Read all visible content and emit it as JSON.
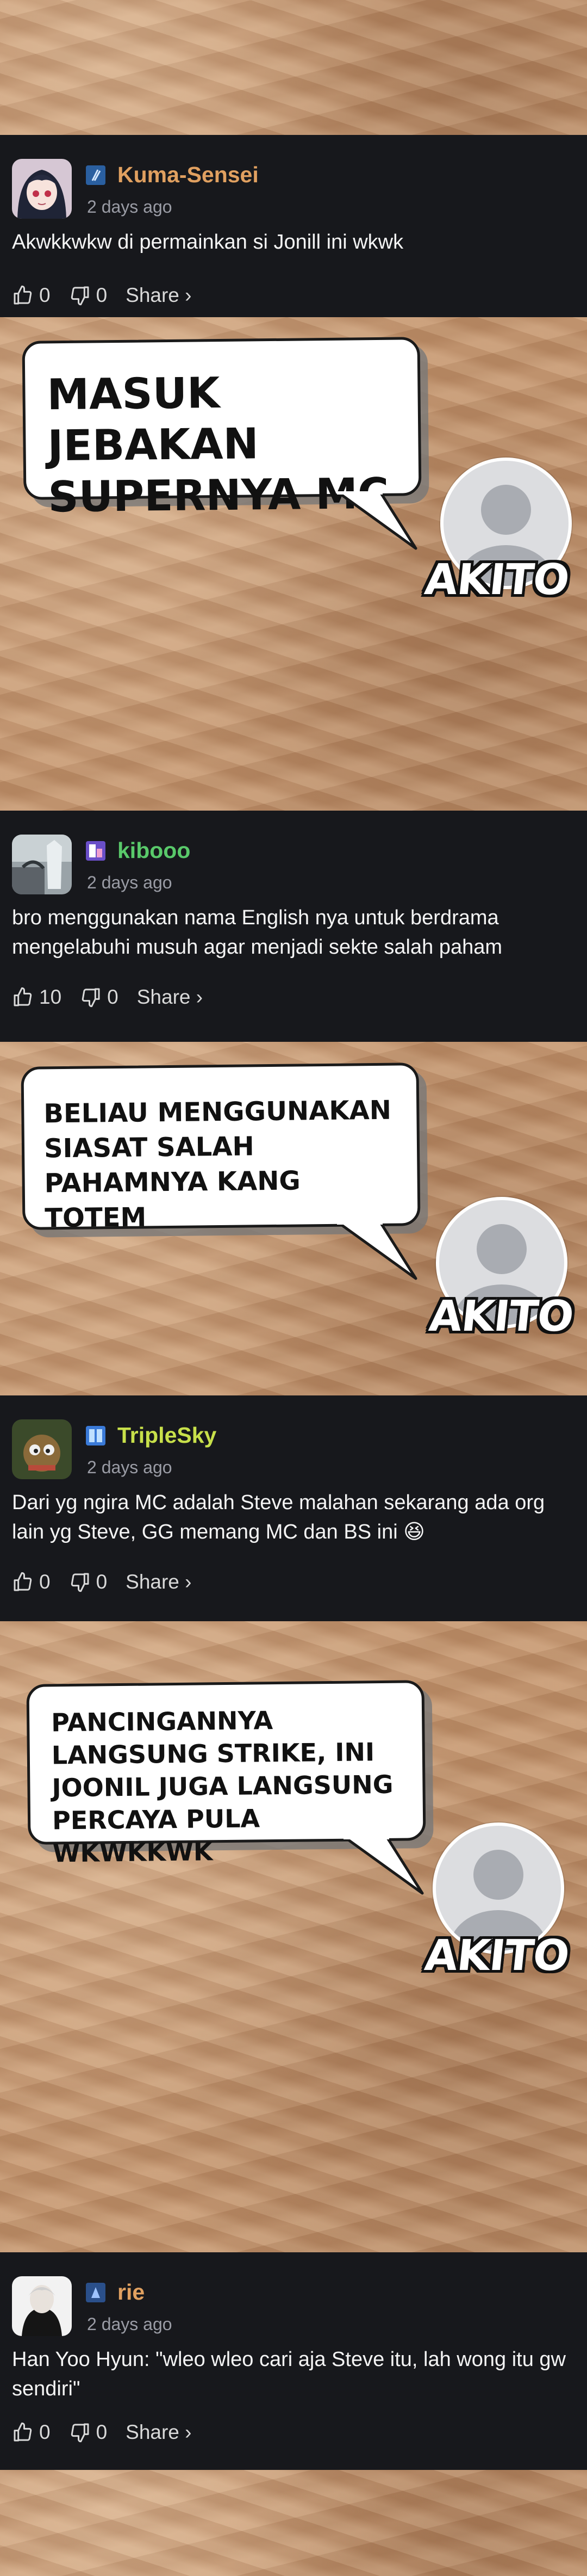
{
  "comments": [
    {
      "username": "Kuma-Sensei",
      "username_color": "#e0a060",
      "time": "2 days ago",
      "text": "Akwkkwkw di permainkan si Jonill ini wkwk",
      "likes": "0",
      "dislikes": "0",
      "share": "Share ›"
    },
    {
      "username": "kibooo",
      "username_color": "#59c96a",
      "time": "2 days ago",
      "text": "bro menggunakan nama English nya untuk berdrama mengelabuhi musuh agar menjadi sekte salah paham",
      "likes": "10",
      "dislikes": "0",
      "share": "Share ›"
    },
    {
      "username": "TripleSky",
      "username_color": "#c8e04a",
      "time": "2 days ago",
      "text": "Dari yg ngira MC adalah Steve malahan sekarang ada org lain yg Steve, GG memang MC dan BS ini 😆",
      "likes": "0",
      "dislikes": "0",
      "share": "Share ›"
    },
    {
      "username": "rie",
      "username_color": "#e0a060",
      "time": "2 days ago",
      "text": "Han Yoo Hyun: \"wleo wleo cari aja Steve itu, lah wong itu gw sendiri\"",
      "likes": "0",
      "dislikes": "0",
      "share": "Share ›"
    }
  ],
  "reactions": [
    {
      "bubble_text": "MASUK JEBAKAN SUPERNYA MC",
      "character_name": "AKITO"
    },
    {
      "bubble_text": "BELIAU MENGGUNAKAN SIASAT SALAH PAHAMNYA KANG TOTEM",
      "character_name": "AKITO"
    },
    {
      "bubble_text": "PANCINGANNYA LANGSUNG STRIKE, INI JOONIL JUGA LANGSUNG PERCAYA PULA WKWKKWK",
      "character_name": "AKITO"
    }
  ],
  "icons": {
    "like": "thumbs-up-icon",
    "dislike": "thumbs-down-icon"
  }
}
